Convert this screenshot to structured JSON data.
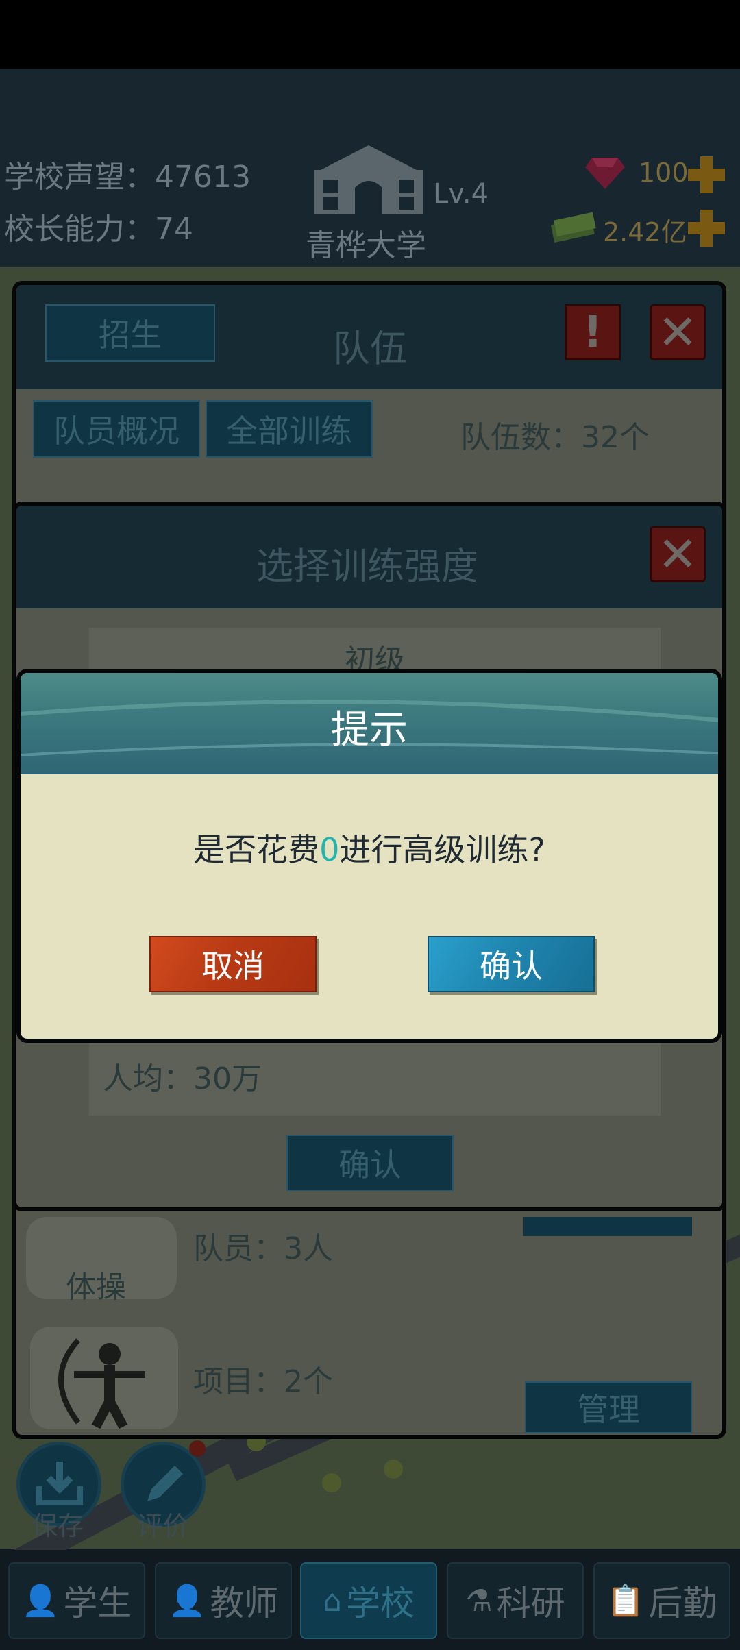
{
  "header": {
    "reputation_label": "学校声望：47613",
    "ability_label": "校长能力：74",
    "school_name": "青桦大学",
    "level": "Lv.4",
    "gems": "100",
    "money": "2.42亿"
  },
  "team_panel": {
    "recruit_button": "招生",
    "title": "队伍",
    "alert_icon": "!",
    "overview_button": "队员概况",
    "train_all_button": "全部训练",
    "team_count": "队伍数：32个"
  },
  "intensity_panel": {
    "title": "选择训练强度",
    "option_label": "初级",
    "per_person": "人均：30万",
    "confirm_button": "确认"
  },
  "sport_list": {
    "members": "队员：3人",
    "sport_name": "体操",
    "projects": "项目：2个",
    "manage_button": "管理"
  },
  "floating_buttons": {
    "save_label": "保存",
    "review_label": "评价"
  },
  "dialog": {
    "title": "提示",
    "message_before": "是否花费",
    "message_highlight": "0",
    "message_after": "进行高级训练?",
    "cancel_button": "取消",
    "confirm_button": "确认",
    "highlight_color": "#22b4ad"
  },
  "bottom_nav": {
    "items": [
      {
        "label": "学生",
        "icon": "student-icon"
      },
      {
        "label": "教师",
        "icon": "teacher-icon"
      },
      {
        "label": "学校",
        "icon": "school-icon"
      },
      {
        "label": "科研",
        "icon": "flask-icon"
      },
      {
        "label": "后勤",
        "icon": "clipboard-icon"
      }
    ],
    "active": "学校"
  }
}
